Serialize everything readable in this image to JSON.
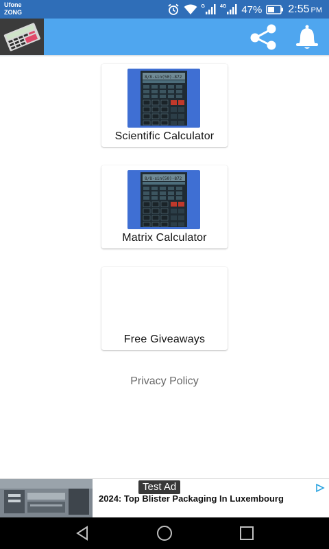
{
  "status_bar": {
    "carrier_1": "Ufone",
    "carrier_2": "ZONG",
    "sim1_network": "G",
    "sim2_network": "4G",
    "battery": "47%",
    "time": "2:55",
    "time_suffix": "PM",
    "icons": [
      "alarm-icon",
      "wifi-icon",
      "signal-icon",
      "battery-icon"
    ]
  },
  "app_bar": {
    "icons": [
      "app-logo-icon",
      "share-icon",
      "bell-icon"
    ],
    "accent_color": "#4fa6ef"
  },
  "menu": [
    {
      "label": "Scientific Calculator",
      "display": "8/8-sin(50)-872"
    },
    {
      "label": "Matrix Calculator",
      "display": "8/8-sin(50)-872"
    },
    {
      "label": "Free Giveaways"
    }
  ],
  "privacy_policy": "Privacy Policy",
  "ad": {
    "badge": "Test Ad",
    "headline": "2024: Top Blister Packaging In Luxembourg"
  },
  "nav_bar": {
    "icons": [
      "back-icon",
      "home-icon",
      "recents-icon"
    ]
  }
}
